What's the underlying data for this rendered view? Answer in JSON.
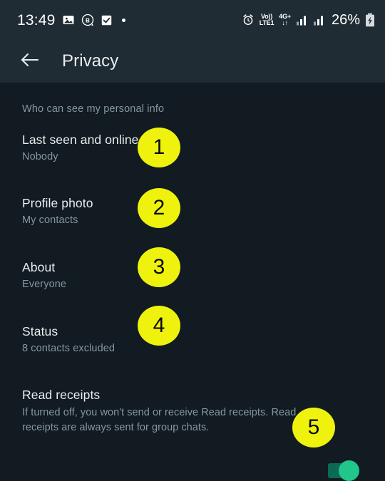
{
  "status_bar": {
    "time": "13:49",
    "left_icons": [
      "image-icon",
      "b-circle-icon",
      "checkbox-checked-icon",
      "dot-icon"
    ],
    "right_icons": [
      "alarm-icon",
      "volte-icon",
      "4g-plus-icon",
      "signal-bars-icon",
      "signal-bars-icon-2",
      "battery-charging-icon"
    ],
    "volte_top": "Vo))",
    "volte_bottom": "LTE1",
    "network_top": "4G+",
    "network_bottom": "↓↑",
    "battery": "26%"
  },
  "app_bar": {
    "back_icon": "back-arrow-icon",
    "title": "Privacy"
  },
  "content": {
    "section_header": "Who can see my personal info",
    "rows": [
      {
        "title": "Last seen and online",
        "subtitle": "Nobody"
      },
      {
        "title": "Profile photo",
        "subtitle": "My contacts"
      },
      {
        "title": "About",
        "subtitle": "Everyone"
      },
      {
        "title": "Status",
        "subtitle": "8 contacts excluded"
      }
    ],
    "read_receipts": {
      "title": "Read receipts",
      "description": "If turned off, you won't send or receive Read receipts. Read receipts are always sent for group chats.",
      "toggle_state": "on"
    }
  },
  "badges": [
    {
      "label": "1"
    },
    {
      "label": "2"
    },
    {
      "label": "3"
    },
    {
      "label": "4"
    },
    {
      "label": "5"
    }
  ],
  "colors": {
    "badge_yellow": "#EEF20D",
    "header_bg": "#1F2C33",
    "body_bg": "#111B21",
    "toggle_on": "#21C68A",
    "text_primary": "#E9EDEF",
    "text_secondary": "#8696A0"
  }
}
